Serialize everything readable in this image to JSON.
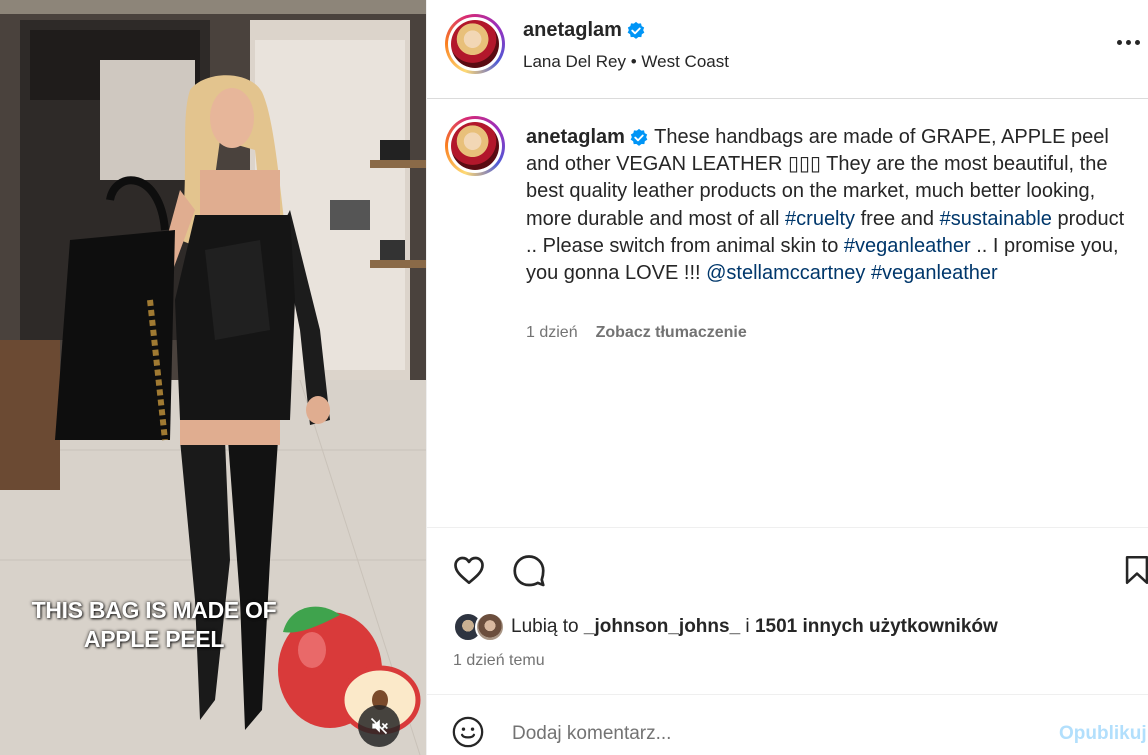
{
  "post": {
    "username": "anetaglam",
    "verified": true,
    "subtitle": "Lana Del Rey • West Coast",
    "more_icon": "more-horizontal-icon"
  },
  "media": {
    "overlay_line1": "THIS BAG IS MADE OF",
    "overlay_line2": "APPLE PEEL",
    "mute_icon": "muted-speaker-icon"
  },
  "caption": {
    "username": "anetaglam",
    "text_1": " These handbags are made of GRAPE, APPLE peel and other VEGAN LEATHER ▯▯▯ They are the most beautiful, the best quality leather products on the market, much better looking, more durable and most of all ",
    "tag_cruelty": "#cruelty",
    "text_2": " free and ",
    "tag_sustainable": "#sustainable",
    "text_3": " product .. Please switch from animal skin to ",
    "tag_veganleather_1": "#veganleather",
    "text_4": " .. I promise you, you gonna LOVE !!! ",
    "mention": "@stellamccartney",
    "text_5": " ",
    "tag_veganleather_2": "#veganleather",
    "time": "1 dzień",
    "translate_label": "Zobacz tłumaczenie"
  },
  "actions": {
    "like_icon": "heart-icon",
    "comment_icon": "comment-icon",
    "save_icon": "bookmark-icon"
  },
  "likes": {
    "prefix": "Lubią to ",
    "user": "_johnson_johns_",
    "middle": " i ",
    "count_text": "1501 innych użytkowników"
  },
  "timeago": "1 dzień temu",
  "comment": {
    "emoji_icon": "emoji-smile-icon",
    "placeholder": "Dodaj komentarz...",
    "publish_label": "Opublikuj"
  },
  "colors": {
    "link": "#00376b",
    "muted": "#737373",
    "verified": "#0095f6",
    "publish_disabled": "#b2dffc"
  }
}
